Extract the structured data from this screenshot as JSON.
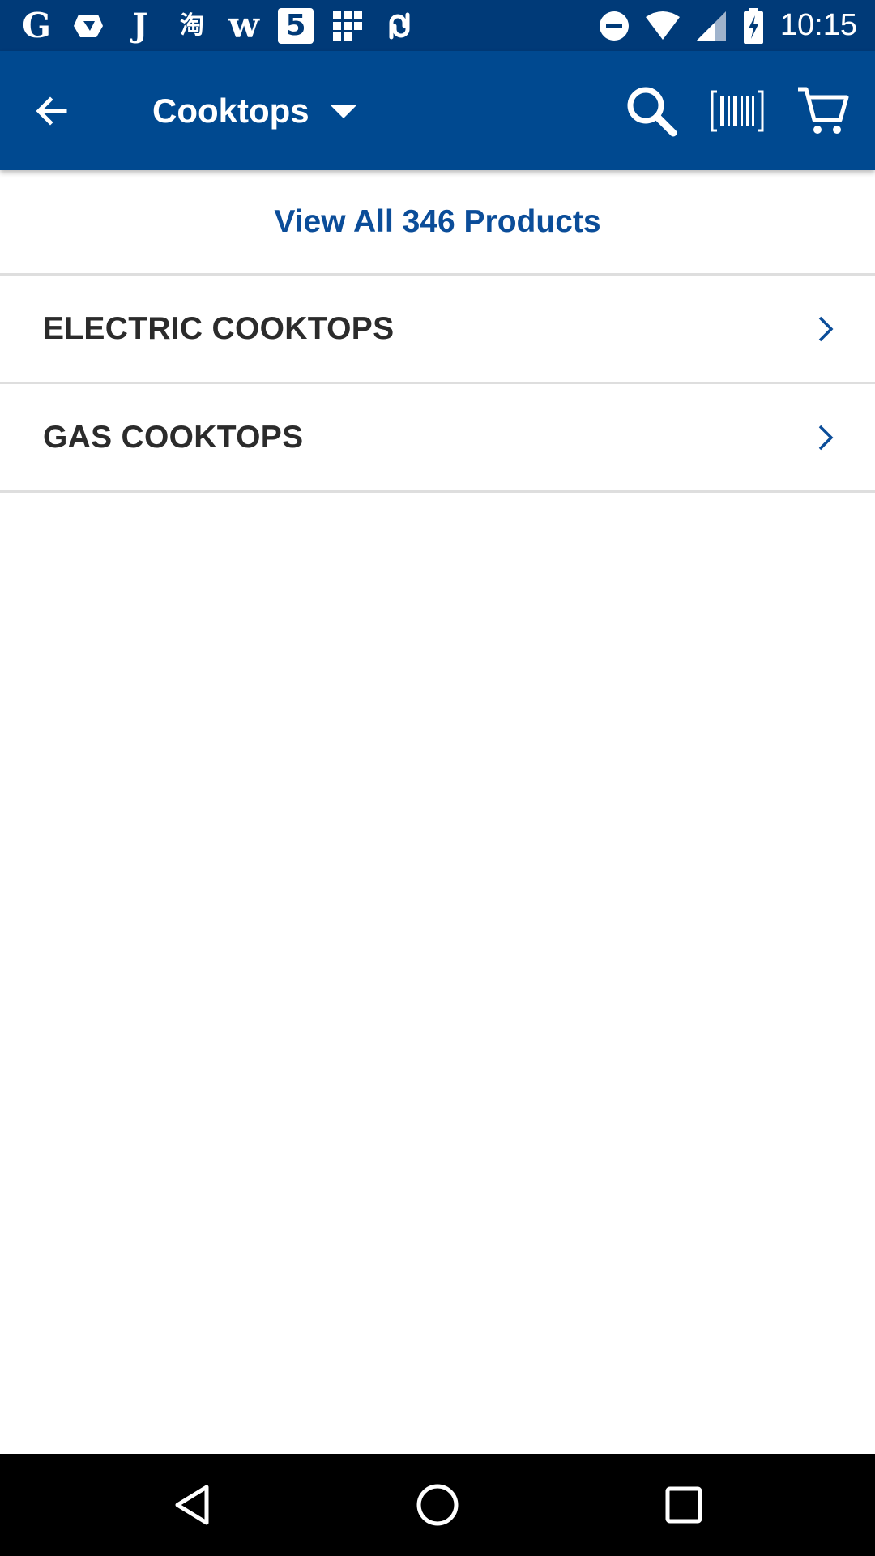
{
  "status_bar": {
    "time": "10:15",
    "notification_icons": [
      "google-icon",
      "drive-icon",
      "j-icon",
      "taobao-icon",
      "w-icon",
      "five-icon",
      "grid-icon",
      "link-icon"
    ],
    "system_icons": [
      "do-not-disturb-icon",
      "wifi-icon",
      "cell-signal-icon",
      "battery-charging-icon"
    ],
    "glyphs": {
      "google": "G",
      "j": "J",
      "taobao": "淘",
      "w": "w",
      "five": "5"
    }
  },
  "app_bar": {
    "title": "Cooktops",
    "actions": [
      "search-icon",
      "barcode-scan-icon",
      "cart-icon"
    ]
  },
  "content": {
    "view_all_label": "View All 346 Products",
    "categories": [
      {
        "label": "ELECTRIC COOKTOPS"
      },
      {
        "label": "GAS COOKTOPS"
      }
    ]
  },
  "nav_bar": {
    "buttons": [
      "back-triangle-icon",
      "home-circle-icon",
      "recents-square-icon"
    ]
  },
  "colors": {
    "status_bar": "#003a78",
    "app_bar": "#004990",
    "accent_text": "#0b4d99",
    "category_text": "#2b2b2b",
    "divider": "#dedede",
    "nav_bar": "#000000"
  }
}
